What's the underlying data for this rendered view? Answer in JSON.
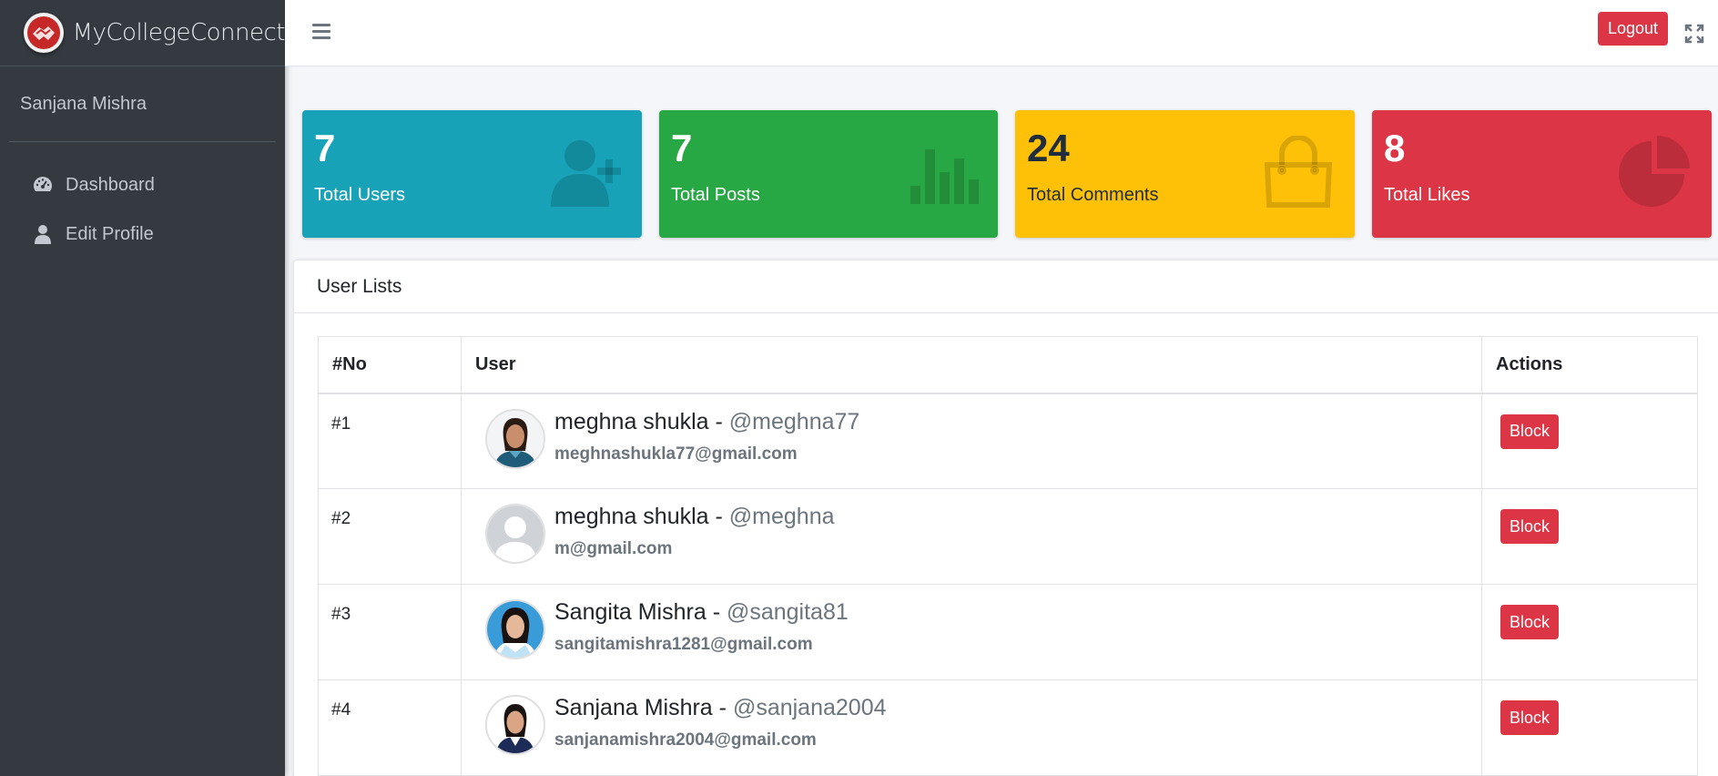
{
  "brand": {
    "name": "MyCollegeConnect"
  },
  "sidebar": {
    "user_name": "Sanjana Mishra",
    "items": [
      {
        "label": "Dashboard",
        "icon": "tachometer-icon"
      },
      {
        "label": "Edit Profile",
        "icon": "user-icon"
      }
    ]
  },
  "header": {
    "logout_label": "Logout"
  },
  "stats": [
    {
      "value": "7",
      "label": "Total Users",
      "icon": "user-plus-icon",
      "color": "#17a2b8"
    },
    {
      "value": "7",
      "label": "Total Posts",
      "icon": "bar-chart-icon",
      "color": "#28a745"
    },
    {
      "value": "24",
      "label": "Total Comments",
      "icon": "shopping-bag-icon",
      "color": "#ffc107"
    },
    {
      "value": "8",
      "label": "Total Likes",
      "icon": "pie-chart-icon",
      "color": "#dc3545"
    }
  ],
  "users_card": {
    "title": "User Lists",
    "columns": [
      "#No",
      "User",
      "Actions"
    ],
    "rows": [
      {
        "no": "#1",
        "name": "meghna shukla",
        "separator": " - ",
        "handle": "@meghna77",
        "email": "meghnashukla77@gmail.com",
        "action": "Block"
      },
      {
        "no": "#2",
        "name": "meghna shukla",
        "separator": " - ",
        "handle": "@meghna",
        "email": "m@gmail.com",
        "action": "Block"
      },
      {
        "no": "#3",
        "name": "Sangita Mishra",
        "separator": " - ",
        "handle": "@sangita81",
        "email": "sangitamishra1281@gmail.com",
        "action": "Block"
      },
      {
        "no": "#4",
        "name": "Sanjana Mishra",
        "separator": " - ",
        "handle": "@sanjana2004",
        "email": "sanjanamishra2004@gmail.com",
        "action": "Block"
      }
    ]
  }
}
